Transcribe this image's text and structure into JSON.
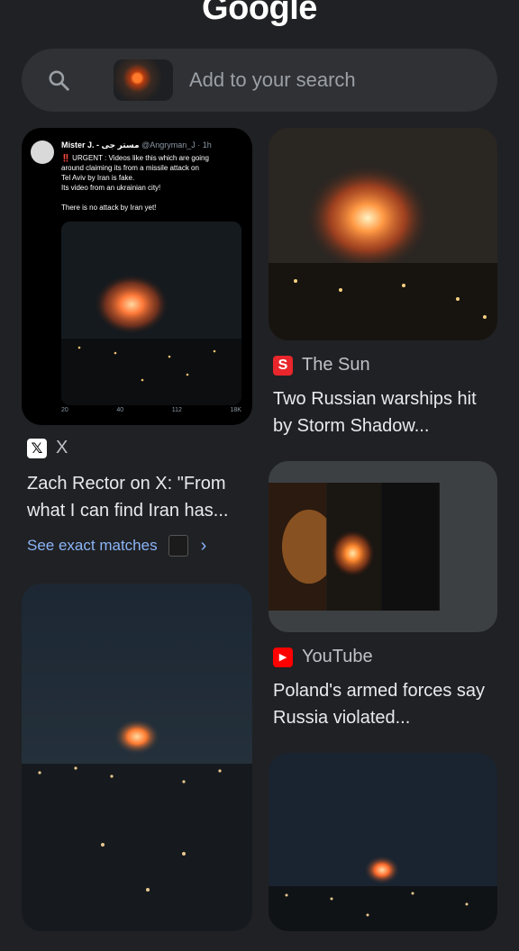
{
  "header": {
    "logo_text": "Google"
  },
  "search": {
    "placeholder": "Add to your search",
    "icon": "search-icon"
  },
  "results": [
    {
      "source": "X",
      "title": "Zach Rector on X: \"From what I can find Iran has...",
      "tweet": {
        "author": "Mister J. - مستر جی",
        "handle": "@Angryman_J · 1h",
        "lines": [
          "‼️ URGENT : Videos like this which are going",
          "around claiming its from a missile attack on",
          "Tel Aviv by Iran is fake.",
          "Its video from an ukrainian city!",
          "",
          "There is no attack by Iran yet!"
        ],
        "stats": [
          "20",
          "40",
          "112",
          "18K"
        ]
      }
    },
    {
      "source": "The Sun",
      "title": "Two Russian warships hit by Storm Shadow..."
    },
    {
      "source": "YouTube",
      "title": "Poland's armed forces say Russia violated..."
    }
  ],
  "exact_matches": {
    "label": "See exact matches"
  },
  "colors": {
    "background": "#202124",
    "link": "#8ab4f8",
    "sun": "#e8262b",
    "youtube": "#ff0000"
  }
}
